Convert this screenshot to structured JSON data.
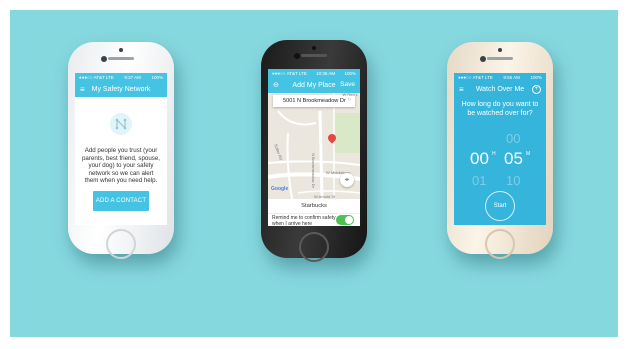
{
  "phone1": {
    "status_left": "●●●○○ AT&T LTE",
    "status_time": "9:37 AM",
    "status_right": "100%",
    "menu_icon": "menu-icon",
    "title": "My Safety Network",
    "body_text": "Add people you trust (your parents, best friend, spouse, your dog) to your safety network so we can alert them when you need help.",
    "button_label": "ADD A CONTACT",
    "accent": "#45c3e2"
  },
  "phone2": {
    "status_left": "●●●○○ AT&T LTE",
    "status_time": "10:36 AM",
    "status_right": "100%",
    "back_icon": "back-arrow-icon",
    "title": "Add My Place",
    "save_label": "Save",
    "address": "5001 N Brookmeadow Dr",
    "street1": "W Red L",
    "street2": "N Brookmeadow Dr",
    "street3": "W Middlebury",
    "street4": "W Arnold St",
    "street5": "Sutter Rd",
    "google_label": "Google",
    "place_name": "Starbucks",
    "remind_text": "Remind me to confirm safety when I arrive here",
    "toggle_on": true
  },
  "phone3": {
    "status_left": "●●●○○ AT&T LTE",
    "status_time": "9:56 AM",
    "status_right": "100%",
    "menu_icon": "menu-icon",
    "title": "Watch Over Me",
    "question": "How long do you want to be watched over for?",
    "hours_prev": "",
    "hours": "00",
    "hours_unit": "H",
    "hours_next": "01",
    "minutes_prev": "00",
    "minutes": "05",
    "minutes_unit": "M",
    "minutes_next": "10",
    "start_label": "Start",
    "background": "#35b4dc"
  }
}
